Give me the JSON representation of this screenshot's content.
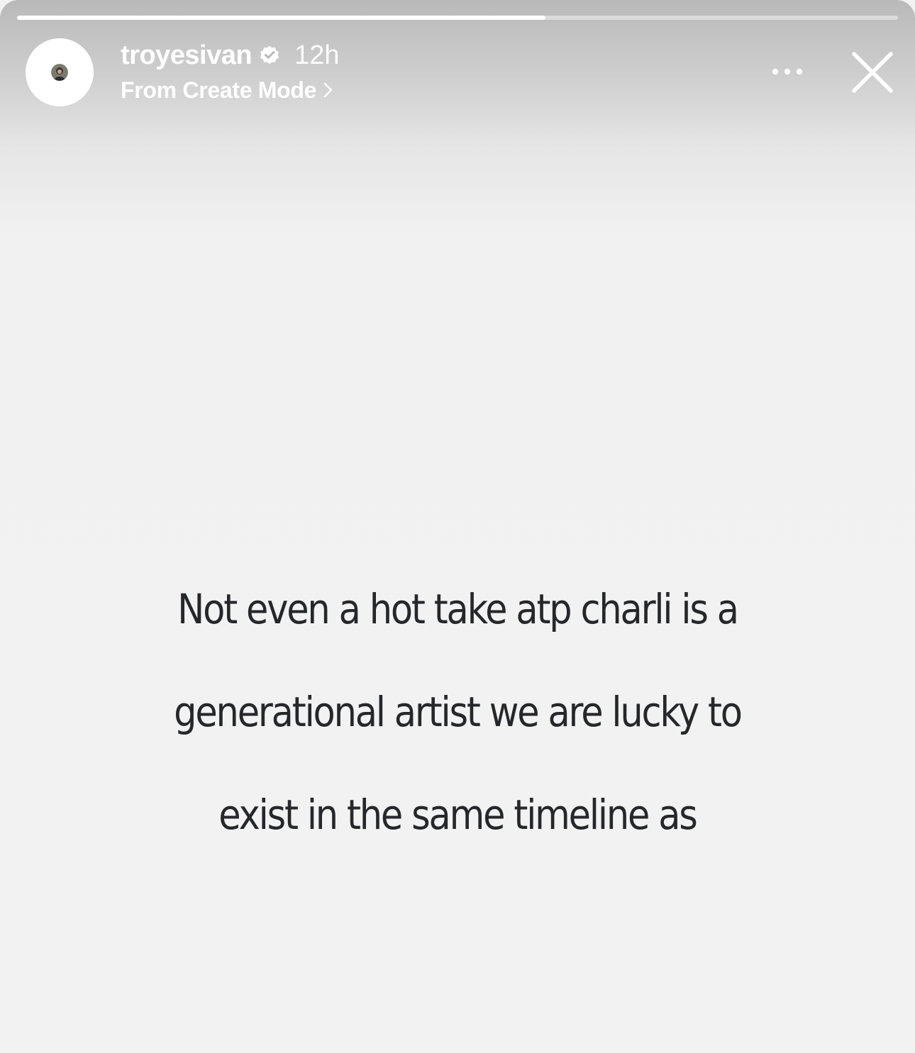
{
  "story": {
    "progress": 0.6,
    "username": "troyesivan",
    "verified_icon": "verified-badge-icon",
    "timestamp": "12h",
    "subtitle": "From Create Mode",
    "subtitle_icon": "chevron-right-icon",
    "more_icon": "more-horizontal-icon",
    "close_icon": "close-icon",
    "caption_lines": [
      "Not even a hot take atp charli is a",
      "generational artist we are lucky to",
      "exist in the same timeline as"
    ],
    "caption_color": "#26272b",
    "background_color": "#f2f2f2"
  }
}
